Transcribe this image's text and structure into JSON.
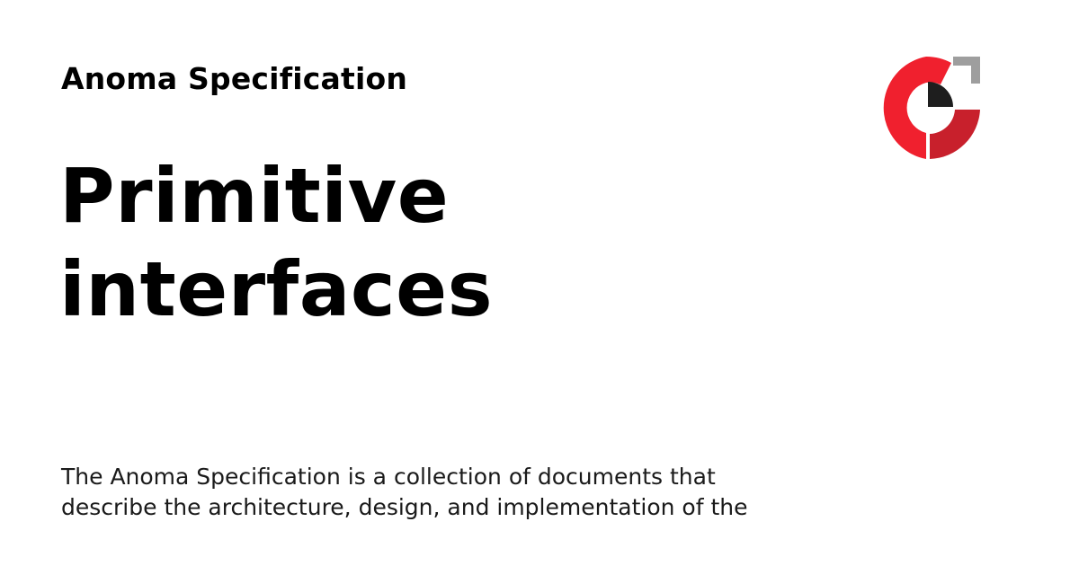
{
  "site": {
    "name": "Anoma Specification"
  },
  "page": {
    "title_lines": [
      "Primitive",
      "interfaces"
    ],
    "description_lines": [
      "The Anoma Specification is a collection of documents that",
      "describe the architecture, design, and implementation of the"
    ]
  },
  "logo": {
    "icon": "anoma-logo-icon",
    "colors": {
      "red": "#f0202e",
      "dark_red": "#c8202c",
      "black": "#1e1e1e",
      "gray": "#9e9e9e"
    }
  }
}
